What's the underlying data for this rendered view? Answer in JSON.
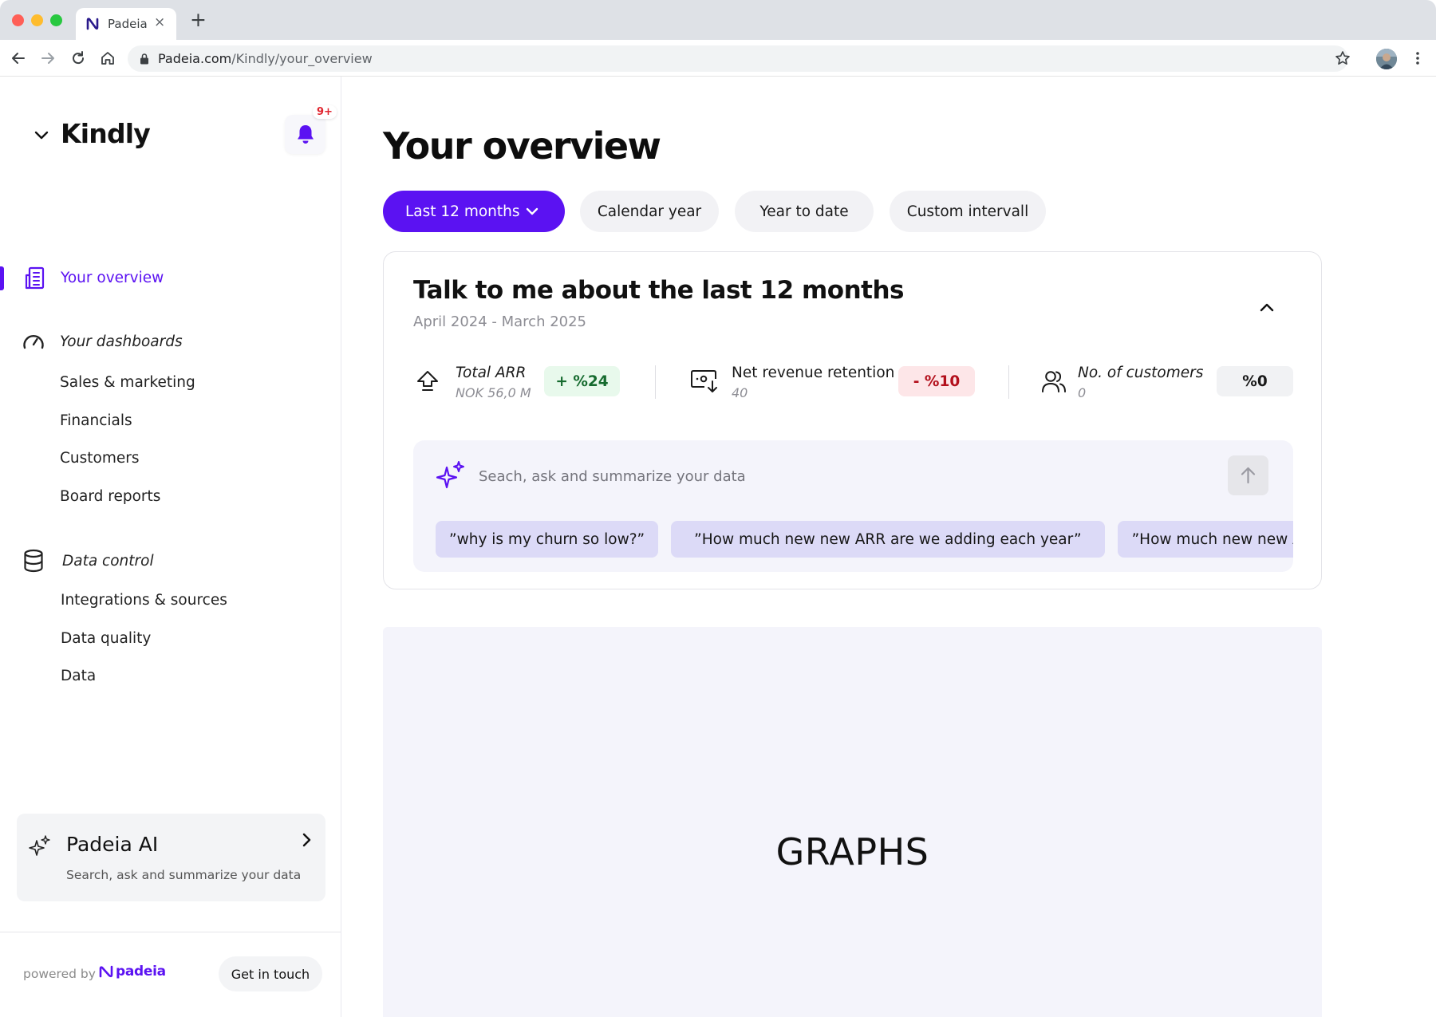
{
  "browser": {
    "tab_title": "Padeia",
    "tab_close": "×",
    "new_tab": "+",
    "url_host": "Padeia.com",
    "url_path": "/Kindly/your_overview"
  },
  "sidebar": {
    "workspace_name": "Kindly",
    "notification_badge": "9+",
    "overview_label": "Your overview",
    "dashboards_label": "Your dashboards",
    "dashboards_items": [
      "Sales & marketing",
      "Financials",
      "Customers",
      "Board reports"
    ],
    "data_control_label": "Data control",
    "data_control_items": [
      "Integrations & sources",
      "Data quality",
      "Data"
    ],
    "ai_card": {
      "title": "Padeia AI",
      "subtitle": "Search, ask and summarize your data"
    },
    "footer": {
      "powered_by": "powered by",
      "logo_text": "padeia",
      "get_in_touch": "Get in touch"
    }
  },
  "main": {
    "title": "Your overview",
    "periods": [
      "Last 12 months",
      "Calendar year",
      "Year to date",
      "Custom intervall"
    ],
    "selected_period": "Last 12 months",
    "summary": {
      "title": "Talk to me about the last 12 months",
      "range": "April 2024 - March 2025",
      "metrics": [
        {
          "label": "Total ARR",
          "sub": "NOK 56,0 M",
          "change": "+ %24"
        },
        {
          "label": "Net revenue retention",
          "sub": "40",
          "change": "- %10"
        },
        {
          "label": "No. of customers",
          "sub": "0",
          "change": "%0"
        }
      ]
    },
    "ask": {
      "placeholder": "Seach, ask and summarize your data",
      "suggestions": [
        "”why is my churn so low?”",
        "”How much new new ARR are we adding each year”",
        "”How much new new ARR are we adding each year”"
      ]
    },
    "graphs_placeholder": "GRAPHS"
  },
  "colors": {
    "accent": "#5b12f2",
    "positive_bg": "#e8f9ec",
    "negative_bg": "#fde6e8",
    "neutral_bg": "#f1f2f4",
    "panel_bg": "#f4f4fb",
    "chip_bg": "#dcdaf7"
  },
  "icons": {
    "favicon": "padeia-logo-icon",
    "bell": "bell-icon",
    "overview": "building-icon",
    "dashboards": "gauge-icon",
    "data_control": "database-icon",
    "ai": "sparkle-icon",
    "arr": "upload-arrow-icon",
    "nrr": "cash-down-icon",
    "customers": "users-icon"
  }
}
